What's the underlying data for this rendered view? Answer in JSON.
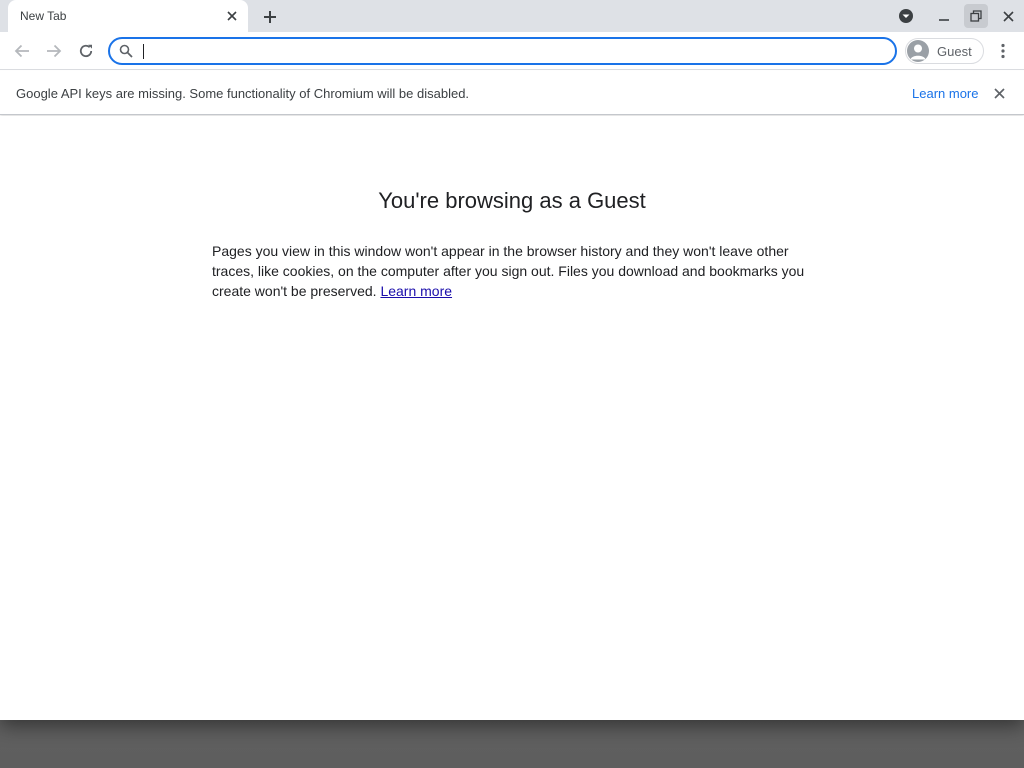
{
  "tab": {
    "title": "New Tab"
  },
  "omnibox": {
    "value": "",
    "placeholder": ""
  },
  "profile": {
    "label": "Guest"
  },
  "infobar": {
    "message": "Google API keys are missing. Some functionality of Chromium will be disabled.",
    "link": "Learn more"
  },
  "page": {
    "heading": "You're browsing as a Guest",
    "body": "Pages you view in this window won't appear in the browser history and they won't leave other traces, like cookies, on the computer after you sign out. Files you download and bookmarks you create won't be preserved.",
    "link": "Learn more"
  },
  "colors": {
    "accent": "#1a73e8",
    "tabstrip": "#dee1e6",
    "link": "#1a0dab"
  }
}
